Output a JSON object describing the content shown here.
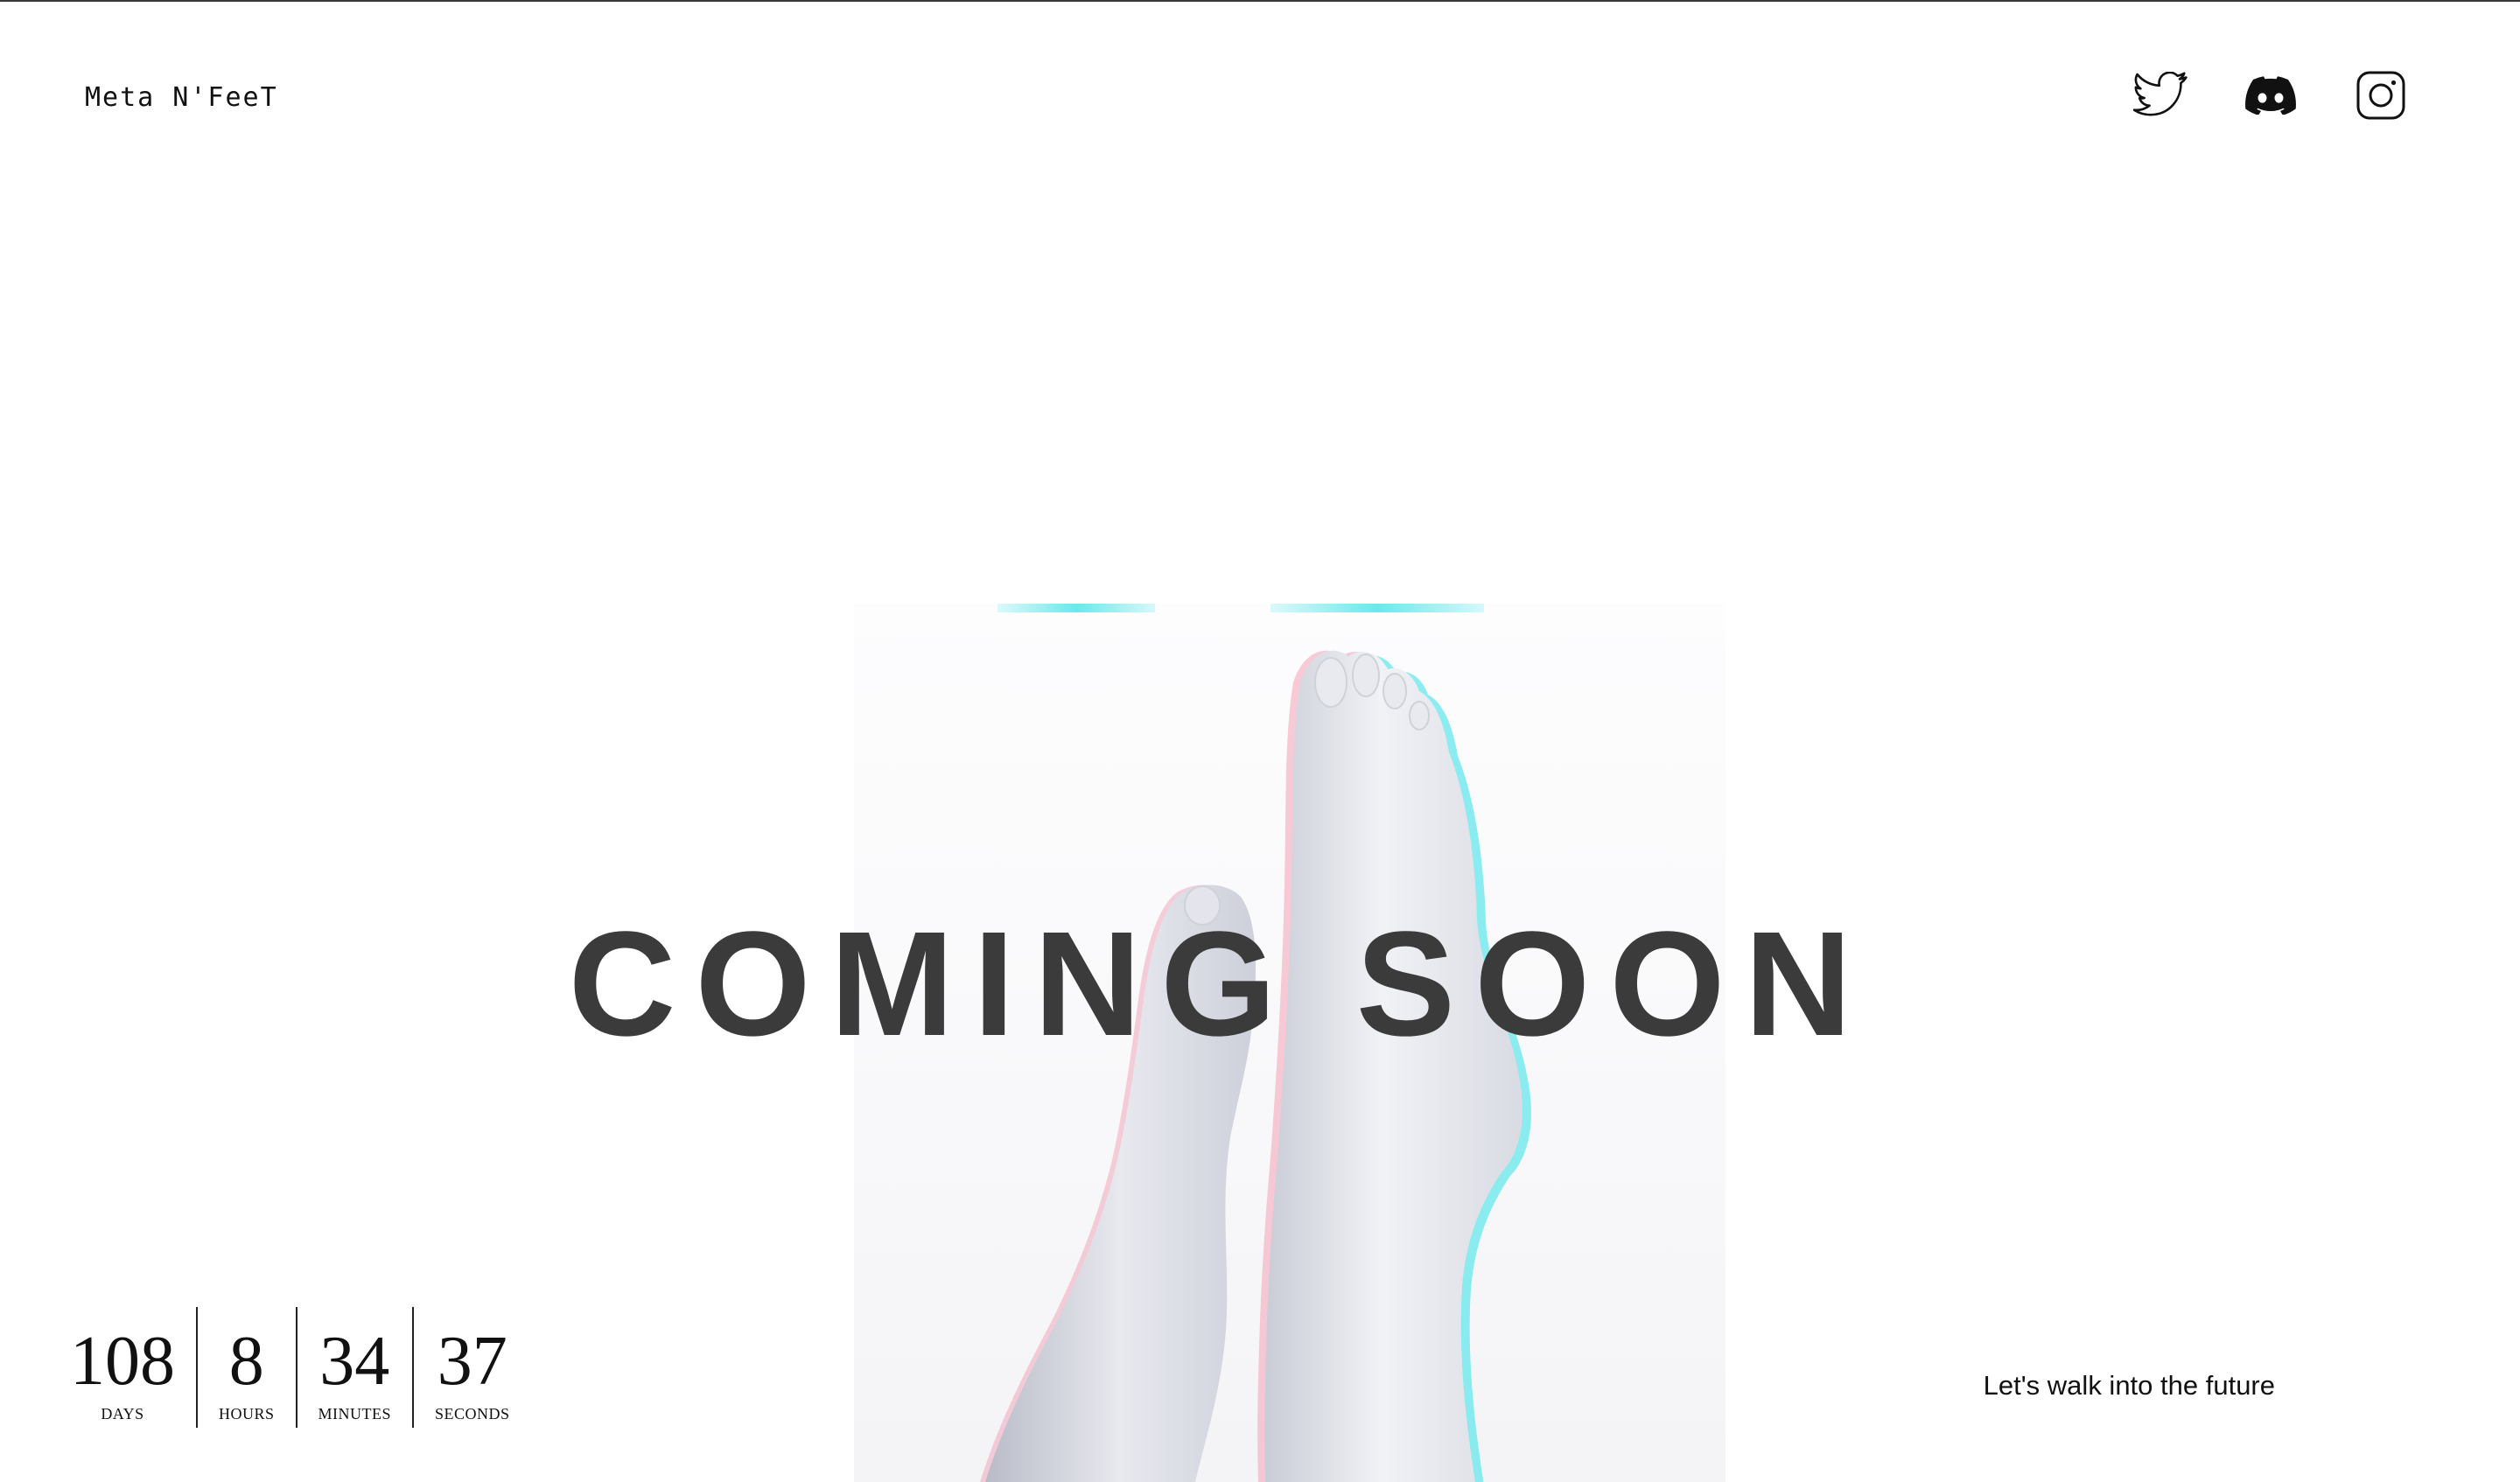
{
  "header": {
    "brand": "Meta N'FeeT",
    "socials": [
      {
        "name": "twitter",
        "icon": "twitter-icon"
      },
      {
        "name": "discord",
        "icon": "discord-icon"
      },
      {
        "name": "instagram",
        "icon": "instagram-icon"
      }
    ]
  },
  "hero": {
    "title": "COMING SOON",
    "image": "feet-image",
    "accent_colors": {
      "cyan": "#5fe6eb",
      "pink": "#f2b3c2",
      "title": "#3b3b3b"
    }
  },
  "countdown": {
    "units": [
      {
        "value": "108",
        "label": "DAYS"
      },
      {
        "value": "8",
        "label": "HOURS"
      },
      {
        "value": "34",
        "label": "MINUTES"
      },
      {
        "value": "37",
        "label": "SECONDS"
      }
    ]
  },
  "footer": {
    "tagline": "Let's walk into the future"
  }
}
